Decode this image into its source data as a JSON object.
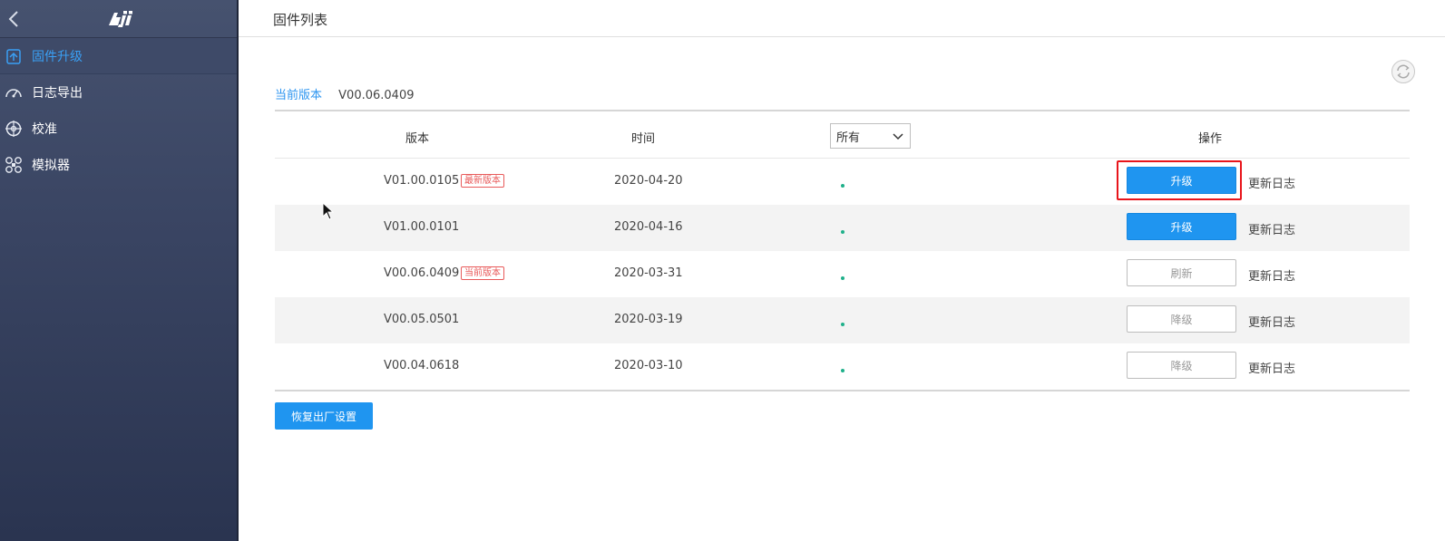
{
  "header": {
    "title": "固件列表"
  },
  "sidebar": {
    "items": [
      {
        "label": "固件升级",
        "icon": "firmware-upgrade-icon",
        "active": true
      },
      {
        "label": "日志导出",
        "icon": "gauge-icon",
        "active": false
      },
      {
        "label": "校准",
        "icon": "calibration-icon",
        "active": false
      },
      {
        "label": "模拟器",
        "icon": "drone-icon",
        "active": false
      }
    ]
  },
  "current_version": {
    "label": "当前版本",
    "value": "V00.06.0409"
  },
  "table": {
    "headers": {
      "version": "版本",
      "time": "时间",
      "operation": "操作"
    },
    "filter": {
      "selected": "所有"
    },
    "rows": [
      {
        "version": "V01.00.0105",
        "badge": "最新版本",
        "time": "2020-04-20",
        "action": "升级",
        "log": "更新日志"
      },
      {
        "version": "V01.00.0101",
        "badge": "",
        "time": "2020-04-16",
        "action": "升级",
        "log": "更新日志"
      },
      {
        "version": "V00.06.0409",
        "badge": "当前版本",
        "time": "2020-03-31",
        "action": "刷新",
        "log": "更新日志"
      },
      {
        "version": "V00.05.0501",
        "badge": "",
        "time": "2020-03-19",
        "action": "降级",
        "log": "更新日志"
      },
      {
        "version": "V00.04.0618",
        "badge": "",
        "time": "2020-03-10",
        "action": "降级",
        "log": "更新日志"
      }
    ]
  },
  "reset_button": "恢复出厂设置",
  "colors": {
    "accent": "#1f95f0",
    "highlight": "#e8151b",
    "badge": "#e85a5a",
    "status_dot": "#1fb08a"
  }
}
